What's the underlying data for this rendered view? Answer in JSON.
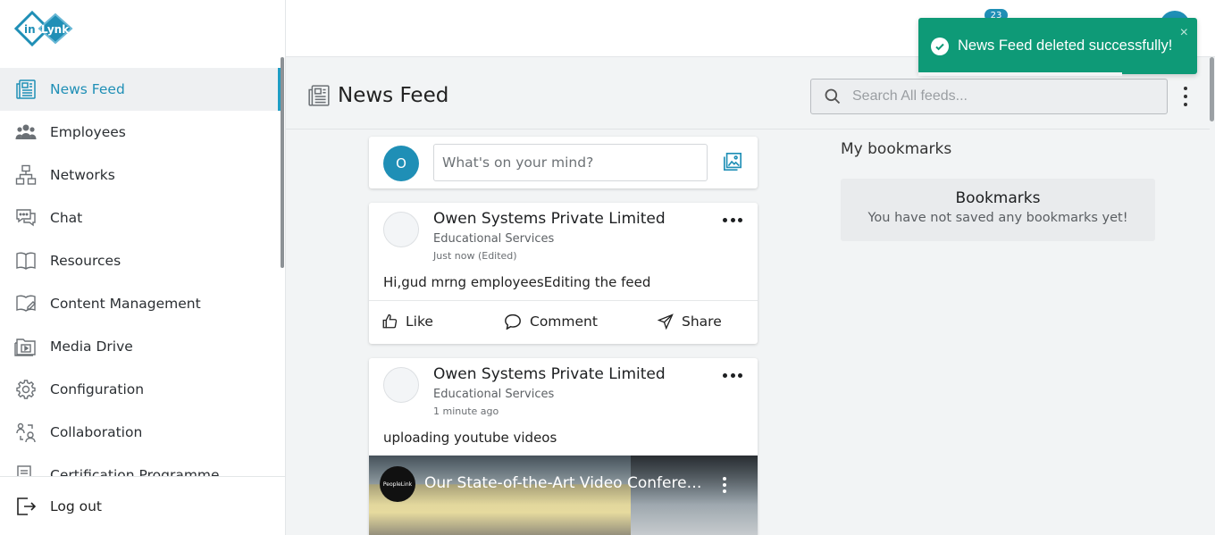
{
  "brand": {
    "logo_text_in": "in",
    "logo_text_lynk": "Lynk"
  },
  "colors": {
    "accent": "#1f8fb6",
    "toast": "#0e9a77",
    "active_bg": "#eef0f2"
  },
  "sidebar": {
    "items": [
      {
        "label": "News Feed",
        "icon": "newspaper-icon",
        "active": true
      },
      {
        "label": "Employees",
        "icon": "group-icon"
      },
      {
        "label": "Networks",
        "icon": "network-icon"
      },
      {
        "label": "Chat",
        "icon": "chat-icon"
      },
      {
        "label": "Resources",
        "icon": "book-icon"
      },
      {
        "label": "Content Management",
        "icon": "content-icon"
      },
      {
        "label": "Media Drive",
        "icon": "media-folder-icon"
      },
      {
        "label": "Configuration",
        "icon": "gear-icon"
      },
      {
        "label": "Collaboration",
        "icon": "collaboration-icon"
      },
      {
        "label": "Certification Programme",
        "icon": "certificate-icon"
      }
    ],
    "logout": "Log out"
  },
  "topbar": {
    "notification_count": "23"
  },
  "header": {
    "title": "News Feed",
    "search_placeholder": "Search All feeds..."
  },
  "composer": {
    "avatar_letter": "O",
    "placeholder": "What's on your mind?"
  },
  "posts": [
    {
      "org": "Owen Systems Private Limited",
      "category": "Educational Services",
      "time": "Just now (Edited)",
      "text": "Hi,gud mrng employeesEditing the feed",
      "actions": {
        "like": "Like",
        "comment": "Comment",
        "share": "Share"
      }
    },
    {
      "org": "Owen Systems Private Limited",
      "category": "Educational Services",
      "time": "1 minute ago",
      "text": "uploading youtube videos",
      "video": {
        "title": "Our State-of-the-Art Video Conferencing Studio",
        "channel": "PeopleLink"
      }
    }
  ],
  "bookmarks": {
    "heading": "My bookmarks",
    "title": "Bookmarks",
    "empty": "You have not saved any bookmarks yet!"
  },
  "toast": {
    "message": "News Feed deleted successfully!",
    "close": "×"
  }
}
